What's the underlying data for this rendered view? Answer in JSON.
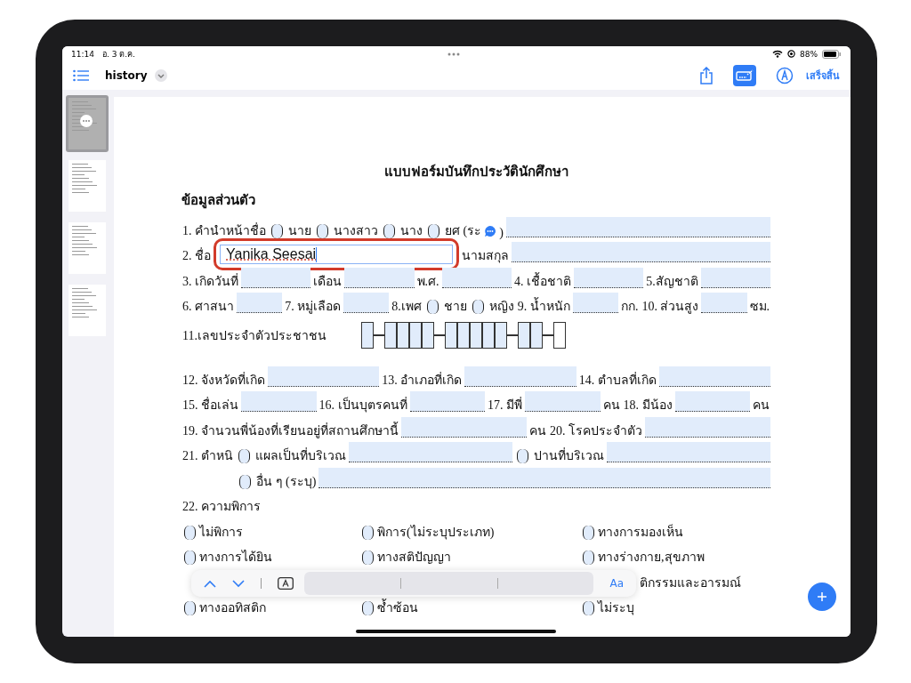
{
  "status_bar": {
    "time": "11:14",
    "date": "อ. 3 ต.ค.",
    "battery": "88%"
  },
  "nav": {
    "title": "history",
    "done": "เสร็จสิ้น",
    "markup_selected": true
  },
  "thumbnails": [
    {
      "selected": true
    },
    {
      "selected": false
    },
    {
      "selected": false
    },
    {
      "selected": false
    }
  ],
  "document": {
    "title": "แบบฟอร์มบันทึกประวัตินักศึกษา",
    "section": "ข้อมูลส่วนตัว",
    "lines": [
      [
        {
          "kind": "text",
          "text": "1. คำนำหน้าชื่อ"
        },
        {
          "kind": "check",
          "checked": false
        },
        {
          "kind": "text",
          "text": "นาย"
        },
        {
          "kind": "check",
          "checked": false
        },
        {
          "kind": "text",
          "text": "นางสาว"
        },
        {
          "kind": "check",
          "checked": false
        },
        {
          "kind": "text",
          "text": "นาง"
        },
        {
          "kind": "check",
          "checked": false
        },
        {
          "kind": "text",
          "text": "ยศ (ระ"
        },
        {
          "kind": "bubble"
        },
        {
          "kind": "text",
          "text": ")"
        },
        {
          "kind": "field"
        }
      ],
      [
        {
          "kind": "text",
          "text": "2. ชื่อ"
        },
        {
          "kind": "input",
          "value": "Yanika  Seesai",
          "focused": true
        },
        {
          "kind": "text",
          "text": "นามสกุล"
        },
        {
          "kind": "field"
        }
      ],
      [
        {
          "kind": "text",
          "text": "3. เกิดวันที่"
        },
        {
          "kind": "field"
        },
        {
          "kind": "text",
          "text": "เดือน"
        },
        {
          "kind": "field"
        },
        {
          "kind": "text",
          "text": "พ.ศ."
        },
        {
          "kind": "field"
        },
        {
          "kind": "text",
          "text": "4. เชื้อชาติ"
        },
        {
          "kind": "field"
        },
        {
          "kind": "text",
          "text": "5.สัญชาติ"
        },
        {
          "kind": "field"
        }
      ],
      [
        {
          "kind": "text",
          "text": "6. ศาสนา"
        },
        {
          "kind": "field"
        },
        {
          "kind": "text",
          "text": "7. หมู่เลือด"
        },
        {
          "kind": "field"
        },
        {
          "kind": "text",
          "text": "8.เพศ"
        },
        {
          "kind": "check",
          "checked": false
        },
        {
          "kind": "text",
          "text": "ชาย"
        },
        {
          "kind": "check",
          "checked": false
        },
        {
          "kind": "text",
          "text": "หญิง"
        },
        {
          "kind": "text",
          "text": "9. น้ำหนัก"
        },
        {
          "kind": "field"
        },
        {
          "kind": "text",
          "text": "กก."
        },
        {
          "kind": "text",
          "text": "10. ส่วนสูง"
        },
        {
          "kind": "field"
        },
        {
          "kind": "text",
          "text": "ซม."
        }
      ],
      [
        {
          "kind": "text",
          "text": "11.เลขประจำตัวประชาชน"
        },
        {
          "kind": "id",
          "groups": [
            [
              {
                "filled": true
              }
            ],
            [
              {
                "filled": true
              },
              {
                "filled": true
              },
              {
                "filled": true
              },
              {
                "filled": true
              }
            ],
            [
              {
                "filled": true
              },
              {
                "filled": true
              },
              {
                "filled": true
              },
              {
                "filled": true
              },
              {
                "filled": true
              }
            ],
            [
              {
                "filled": true
              },
              {
                "filled": true
              }
            ],
            [
              {
                "filled": false
              }
            ]
          ]
        }
      ],
      [
        {
          "kind": "text",
          "text": "12. จังหวัดที่เกิด"
        },
        {
          "kind": "field"
        },
        {
          "kind": "text",
          "text": "13. อำเภอที่เกิด"
        },
        {
          "kind": "field"
        },
        {
          "kind": "text",
          "text": "14. ตำบลที่เกิด"
        },
        {
          "kind": "field"
        }
      ],
      [
        {
          "kind": "text",
          "text": "15. ชื่อเล่น"
        },
        {
          "kind": "field"
        },
        {
          "kind": "text",
          "text": "16. เป็นบุตรคนที่"
        },
        {
          "kind": "field"
        },
        {
          "kind": "text",
          "text": "17. มีพี่"
        },
        {
          "kind": "field"
        },
        {
          "kind": "text",
          "text": "คน"
        },
        {
          "kind": "text",
          "text": "18. มีน้อง"
        },
        {
          "kind": "field"
        },
        {
          "kind": "text",
          "text": "คน"
        }
      ],
      [
        {
          "kind": "text",
          "text": "19. จำนวนพี่น้องที่เรียนอยู่ที่สถานศึกษานี้"
        },
        {
          "kind": "field"
        },
        {
          "kind": "text",
          "text": "คน"
        },
        {
          "kind": "text",
          "text": "20. โรคประจำตัว"
        },
        {
          "kind": "field"
        }
      ],
      [
        {
          "kind": "text",
          "text": "21. ตำหนิ"
        },
        {
          "kind": "check",
          "checked": false
        },
        {
          "kind": "text",
          "text": "แผลเป็นที่บริเวณ"
        },
        {
          "kind": "field"
        },
        {
          "kind": "check",
          "checked": false
        },
        {
          "kind": "text",
          "text": "ปานที่บริเวณ"
        },
        {
          "kind": "field"
        }
      ],
      [
        {
          "kind": "indent"
        },
        {
          "kind": "check",
          "checked": false
        },
        {
          "kind": "text",
          "text": "อื่น ๆ (ระบุ)"
        },
        {
          "kind": "field"
        }
      ],
      [
        {
          "kind": "text",
          "text": "22. ความพิการ"
        }
      ]
    ],
    "options": [
      [
        {
          "label": "ไม่พิการ",
          "checked": false
        },
        {
          "label": "พิการ(ไม่ระบุประเภท)",
          "checked": false
        },
        {
          "label": "ทางการมองเห็น",
          "checked": false
        }
      ],
      [
        {
          "label": "ทางการได้ยิน",
          "checked": false
        },
        {
          "label": "ทางสติปัญญา",
          "checked": false
        },
        {
          "label": "ทางร่างกาย,สุขภาพ",
          "checked": false
        }
      ],
      [
        {
          "label": "ติกรรมและอารมณ์"
        }
      ],
      [
        {
          "label": "ทางออทิสติก",
          "checked": false
        },
        {
          "label": "ซ้ำซ้อน",
          "checked": false
        },
        {
          "label": "ไม่ระบุ",
          "checked": false
        }
      ]
    ]
  },
  "find_bar": {
    "font_button": "Aa"
  }
}
